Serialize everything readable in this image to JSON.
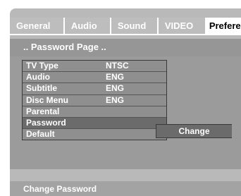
{
  "tabs": [
    {
      "label": "General"
    },
    {
      "label": "Audio"
    },
    {
      "label": "Sound"
    },
    {
      "label": "VIDEO"
    },
    {
      "label": "Prefere"
    }
  ],
  "active_tab": "Preference",
  "page_title": ".. Password  Page ..",
  "menu": [
    {
      "label": "TV  Type",
      "value": "NTSC"
    },
    {
      "label": "Audio",
      "value": "ENG"
    },
    {
      "label": "Subtitle",
      "value": "ENG"
    },
    {
      "label": "Disc Menu",
      "value": "ENG"
    },
    {
      "label": "Parental",
      "value": ""
    },
    {
      "label": "Password",
      "value": ""
    },
    {
      "label": "Default",
      "value": ""
    }
  ],
  "selected_item": "Password",
  "submenu_option": "Change",
  "status_text": "Change Password",
  "colors": {
    "panel": "#b9b9b9",
    "content": "#9b9b9b",
    "selected": "#6b6b6b",
    "text": "#ffffff"
  }
}
